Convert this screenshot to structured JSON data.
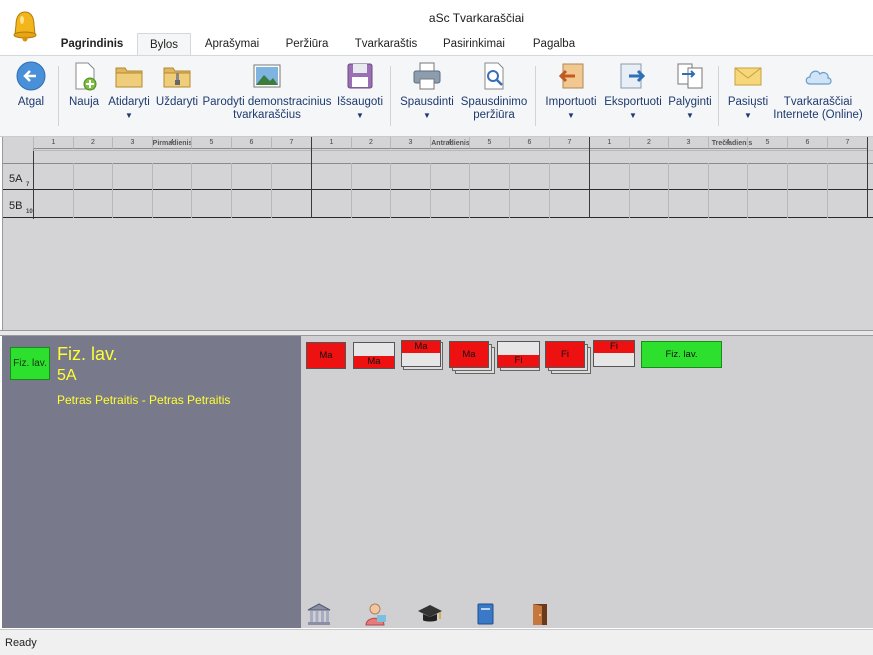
{
  "window": {
    "title": "aSc Tvarkaraščiai"
  },
  "tabs": [
    {
      "label": "Pagrindinis"
    },
    {
      "label": "Bylos"
    },
    {
      "label": "Aprašymai"
    },
    {
      "label": "Peržiūra"
    },
    {
      "label": "Tvarkaraštis"
    },
    {
      "label": "Pasirinkimai"
    },
    {
      "label": "Pagalba"
    }
  ],
  "ribbon": {
    "back": "Atgal",
    "new": "Nauja",
    "open": "Atidaryti",
    "close": "Uždaryti",
    "demo_line1": "Parodyti demonstracinius",
    "demo_line2": "tvarkaraščius",
    "save": "Išsaugoti",
    "print": "Spausdinti",
    "preview_line1": "Spausdinimo",
    "preview_line2": "peržiūra",
    "import": "Importuoti",
    "export": "Eksportuoti",
    "compare": "Palyginti",
    "send": "Pasiųsti",
    "online_line1": "Tvarkaraščiai",
    "online_line2": "Internete (Online)"
  },
  "timetable": {
    "days": [
      "Pirmadienis",
      "Antradienis",
      "Trečiadienis"
    ],
    "periods": [
      "1",
      "2",
      "3",
      "4",
      "5",
      "6",
      "7"
    ],
    "rows": [
      {
        "label": "5A",
        "sub": "7"
      },
      {
        "label": "5B",
        "sub": "10"
      }
    ]
  },
  "info": {
    "card_label": "Fiz. lav.",
    "subject": "Fiz. lav.",
    "class": "5A",
    "teacher": "Petras Petraitis - Petras Petraitis"
  },
  "cards": [
    {
      "label": "Ma"
    },
    {
      "label": "Ma"
    },
    {
      "label": "Ma"
    },
    {
      "label": "Ma"
    },
    {
      "label": "Fi"
    },
    {
      "label": "Fi"
    },
    {
      "label": "Fi"
    },
    {
      "label": "Fiz. lav."
    }
  ],
  "colors": {
    "card_red": "#ee1111",
    "card_green": "#2ee02e",
    "info_text": "#ffff33",
    "info_bg": "#787a8c"
  },
  "bottom_icons": [
    "building-icon",
    "teacher-icon",
    "graduation-cap-icon",
    "book-icon",
    "door-icon"
  ],
  "status": {
    "text": "Ready"
  }
}
